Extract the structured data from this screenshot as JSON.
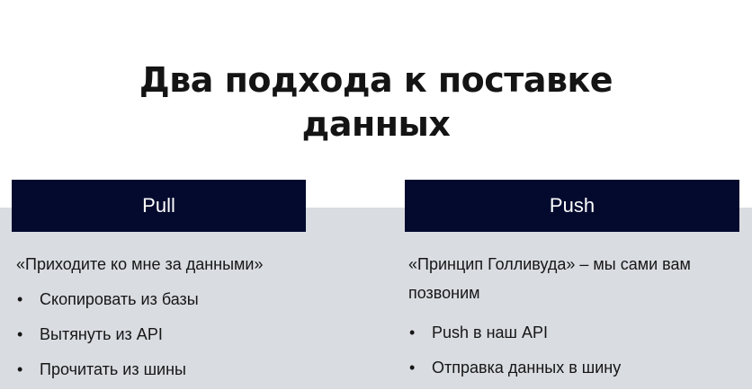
{
  "colors": {
    "header_bg": "#030a2e",
    "band_bg": "#d9dce1",
    "text": "#161616"
  },
  "title": {
    "line1": "Два подхода к поставке",
    "line2": "данных"
  },
  "columns": [
    {
      "header": "Pull",
      "intro": "«Приходите ко мне за данными»",
      "items": [
        "Скопировать из базы",
        "Вытянуть из API",
        "Прочитать из шины"
      ]
    },
    {
      "header": "Push",
      "intro": "«Принцип Голливуда» – мы сами вам позвоним",
      "items": [
        "Push в наш API",
        "Отправка данных в шину"
      ]
    }
  ]
}
